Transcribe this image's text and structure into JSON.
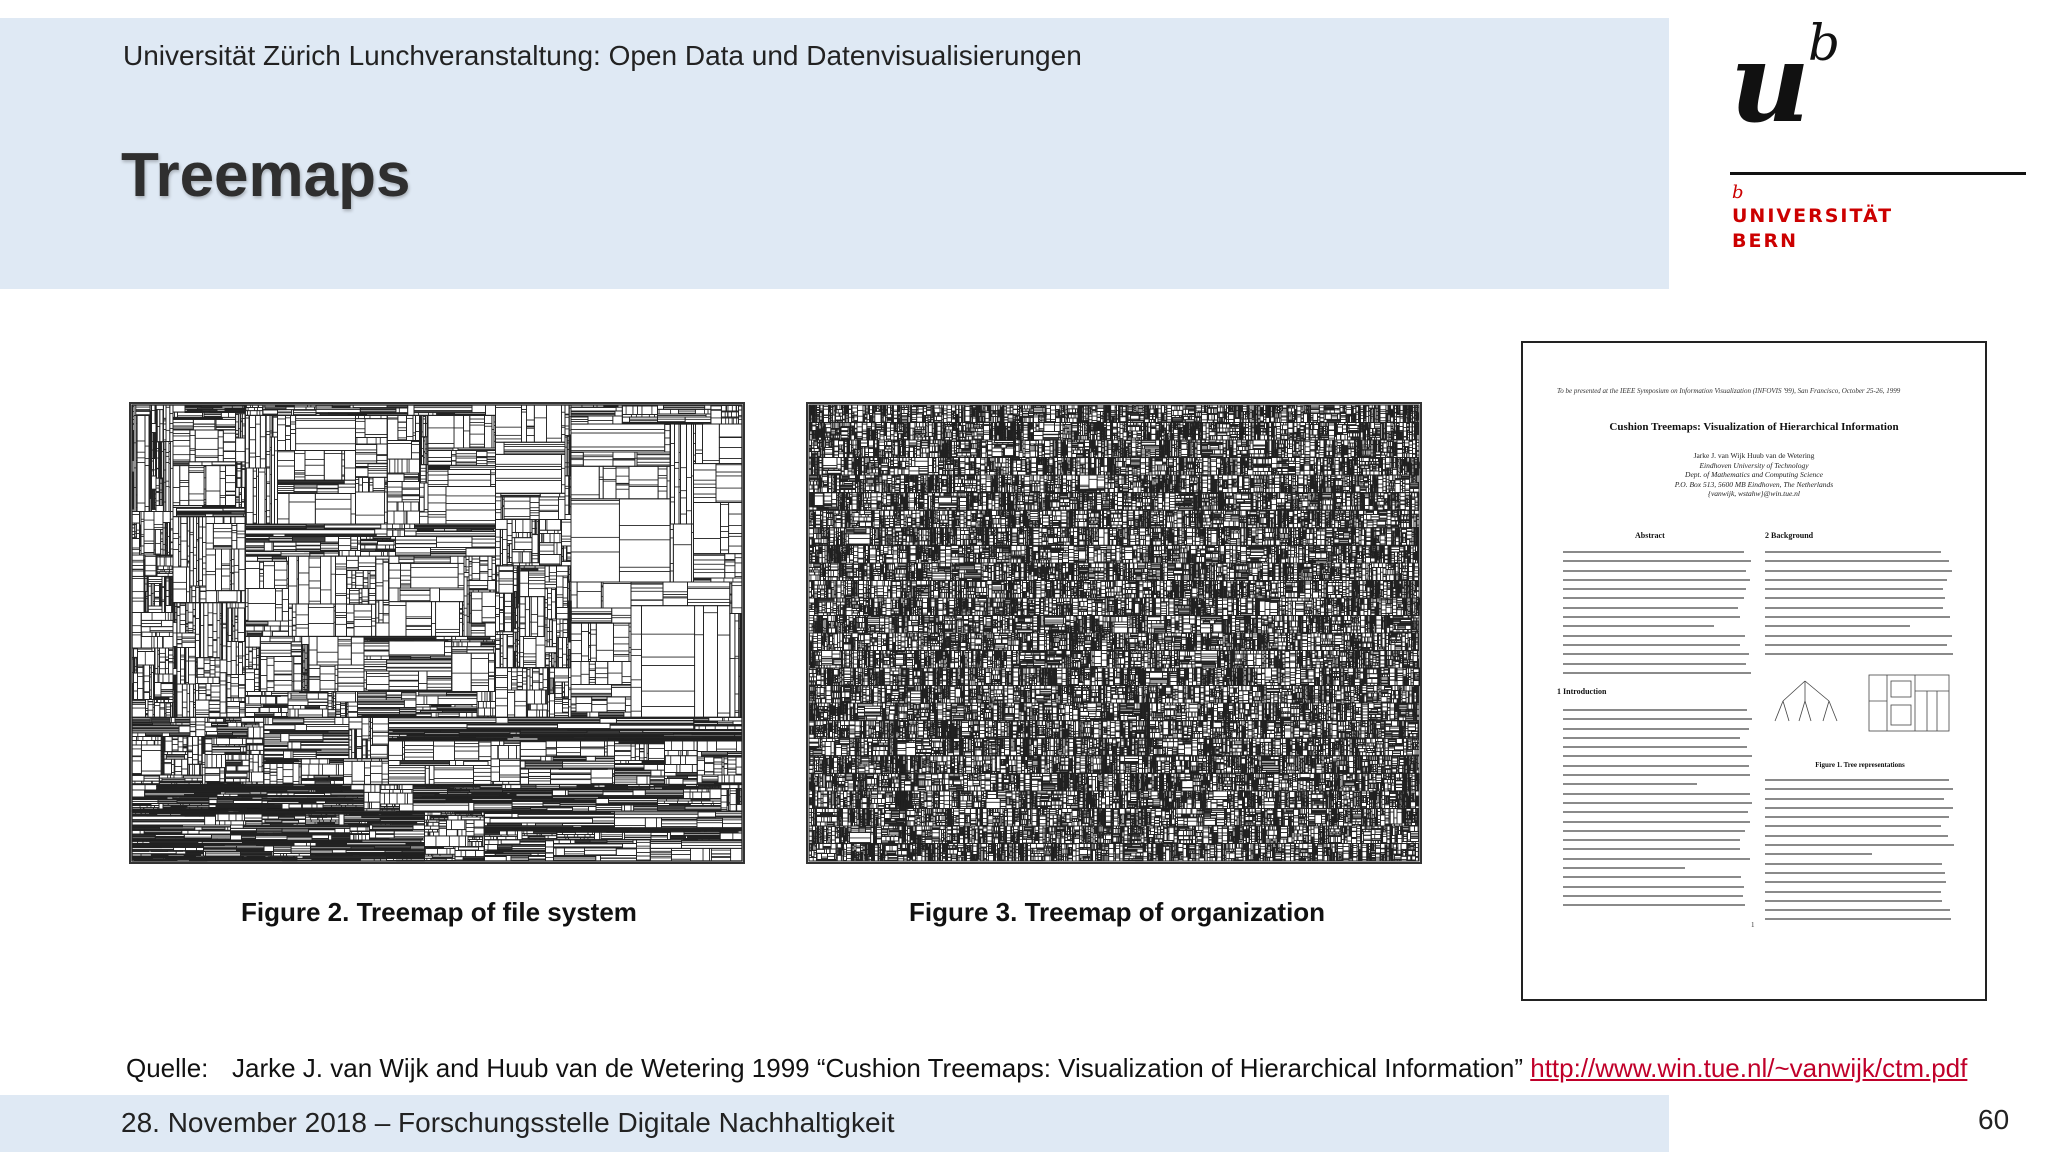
{
  "header": {
    "subtitle": "Universität Zürich Lunchveranstaltung: Open Data und Datenvisualisierungen",
    "title": "Treemaps"
  },
  "logo": {
    "mark_u": "u",
    "mark_b": "b",
    "small_b": "b",
    "name_line1": "UNIVERSITÄT",
    "name_line2": "BERN",
    "color": "#cc0000"
  },
  "figures": [
    {
      "caption": "Figure 2. Treemap of file system",
      "icon": "treemap-image"
    },
    {
      "caption": "Figure 3. Treemap of organization",
      "icon": "treemap-image"
    }
  ],
  "paper": {
    "header_note": "To be presented at the IEEE Symposium on Information Visualization (INFOVIS '99), San Francisco, October 25-26, 1999",
    "title": "Cushion Treemaps: Visualization of Hierarchical Information",
    "authors": "Jarke J. van Wijk        Huub van de Wetering",
    "affiliation": "Eindhoven University of Technology",
    "department": "Dept. of Mathematics and Computing Science",
    "address": "P.O. Box 513, 5600 MB Eindhoven, The Netherlands",
    "email": "{vanwijk, wstahw}@win.tue.nl",
    "abstract_heading": "Abstract",
    "background_heading": "2   Background",
    "introduction_heading": "1   Introduction",
    "figure_caption": "Figure 1. Tree representations",
    "page_number": "1"
  },
  "source": {
    "label": "Quelle:",
    "text": "Jarke J. van Wijk and Huub van de Wetering 1999 “Cushion Treemaps: Visualization of Hierarchical Information” ",
    "link": "http://www.win.tue.nl/~vanwijk/ctm.pdf",
    "link_color": "#c0002a"
  },
  "footer": {
    "text": "28. November 2018 – Forschungsstelle Digitale Nachhaltigkeit",
    "page_number": "60"
  },
  "colors": {
    "band": "#dfe9f4",
    "title": "#2f2f2f"
  }
}
